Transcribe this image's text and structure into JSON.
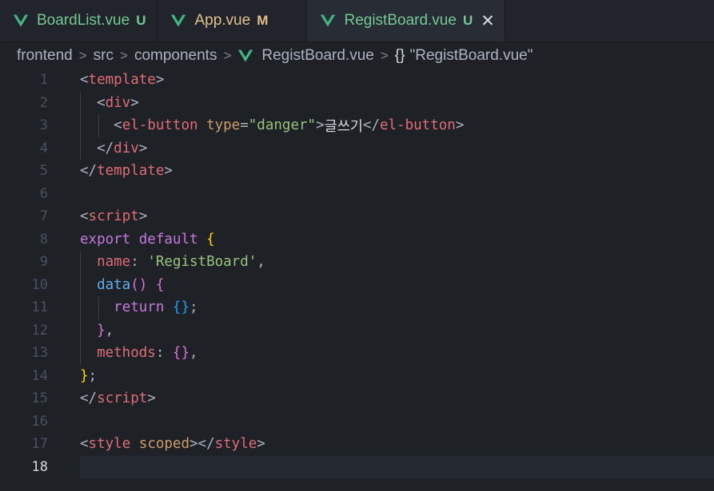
{
  "tabs": [
    {
      "name": "BoardList.vue",
      "badge": "U",
      "badge_color": "#73c991",
      "name_color": "#73c991",
      "active": false
    },
    {
      "name": "App.vue",
      "badge": "M",
      "badge_color": "#e2c08d",
      "name_color": "#e2c08d",
      "active": false
    },
    {
      "name": "RegistBoard.vue",
      "badge": "U",
      "badge_color": "#73c991",
      "name_color": "#73c991",
      "active": true,
      "close": "✕"
    }
  ],
  "breadcrumb": {
    "items": [
      "frontend",
      "src",
      "components",
      "RegistBoard.vue"
    ],
    "symbol_icon": "{}",
    "symbol": "\"RegistBoard.vue\""
  },
  "editor": {
    "current_line": 18,
    "line_numbers": [
      "1",
      "2",
      "3",
      "4",
      "5",
      "6",
      "7",
      "8",
      "9",
      "10",
      "11",
      "12",
      "13",
      "14",
      "15",
      "16",
      "17",
      "18"
    ],
    "lines": [
      [
        [
          "t-p",
          "<"
        ],
        [
          "t-tag",
          "template"
        ],
        [
          "t-p",
          ">"
        ]
      ],
      [
        [
          "t-p",
          "  <"
        ],
        [
          "t-tag",
          "div"
        ],
        [
          "t-p",
          ">"
        ]
      ],
      [
        [
          "t-p",
          "    <"
        ],
        [
          "t-tag",
          "el-button"
        ],
        [
          "t-p",
          " "
        ],
        [
          "t-attr",
          "type"
        ],
        [
          "t-p",
          "="
        ],
        [
          "t-str",
          "\"danger\""
        ],
        [
          "t-p",
          ">"
        ],
        [
          "t-txt",
          "글쓰기"
        ],
        [
          "t-p",
          "</"
        ],
        [
          "t-tag",
          "el-button"
        ],
        [
          "t-p",
          ">"
        ]
      ],
      [
        [
          "t-p",
          "  </"
        ],
        [
          "t-tag",
          "div"
        ],
        [
          "t-p",
          ">"
        ]
      ],
      [
        [
          "t-p",
          "</"
        ],
        [
          "t-tag",
          "template"
        ],
        [
          "t-p",
          ">"
        ]
      ],
      [],
      [
        [
          "t-p",
          "<"
        ],
        [
          "t-tag",
          "script"
        ],
        [
          "t-p",
          ">"
        ]
      ],
      [
        [
          "t-kw",
          "export"
        ],
        [
          "t-p",
          " "
        ],
        [
          "t-kw",
          "default"
        ],
        [
          "t-p",
          " "
        ],
        [
          "t-b1",
          "{"
        ]
      ],
      [
        [
          "t-p",
          "  "
        ],
        [
          "t-tag",
          "name"
        ],
        [
          "t-p",
          ": "
        ],
        [
          "t-str",
          "'RegistBoard'"
        ],
        [
          "t-p",
          ","
        ]
      ],
      [
        [
          "t-p",
          "  "
        ],
        [
          "t-fn",
          "data"
        ],
        [
          "t-b2",
          "()"
        ],
        [
          "t-p",
          " "
        ],
        [
          "t-b2",
          "{"
        ]
      ],
      [
        [
          "t-p",
          "    "
        ],
        [
          "t-kw",
          "return"
        ],
        [
          "t-p",
          " "
        ],
        [
          "t-b3",
          "{}"
        ],
        [
          "t-p",
          ";"
        ]
      ],
      [
        [
          "t-p",
          "  "
        ],
        [
          "t-b2",
          "}"
        ],
        [
          "t-p",
          ","
        ]
      ],
      [
        [
          "t-p",
          "  "
        ],
        [
          "t-tag",
          "methods"
        ],
        [
          "t-p",
          ": "
        ],
        [
          "t-b2",
          "{}"
        ],
        [
          "t-p",
          ","
        ]
      ],
      [
        [
          "t-b1",
          "}"
        ],
        [
          "t-p",
          ";"
        ]
      ],
      [
        [
          "t-p",
          "</"
        ],
        [
          "t-tag",
          "script"
        ],
        [
          "t-p",
          ">"
        ]
      ],
      [],
      [
        [
          "t-p",
          "<"
        ],
        [
          "t-tag",
          "style"
        ],
        [
          "t-p",
          " "
        ],
        [
          "t-attr",
          "scoped"
        ],
        [
          "t-p",
          "></"
        ],
        [
          "t-tag",
          "style"
        ],
        [
          "t-p",
          ">"
        ]
      ],
      []
    ]
  }
}
